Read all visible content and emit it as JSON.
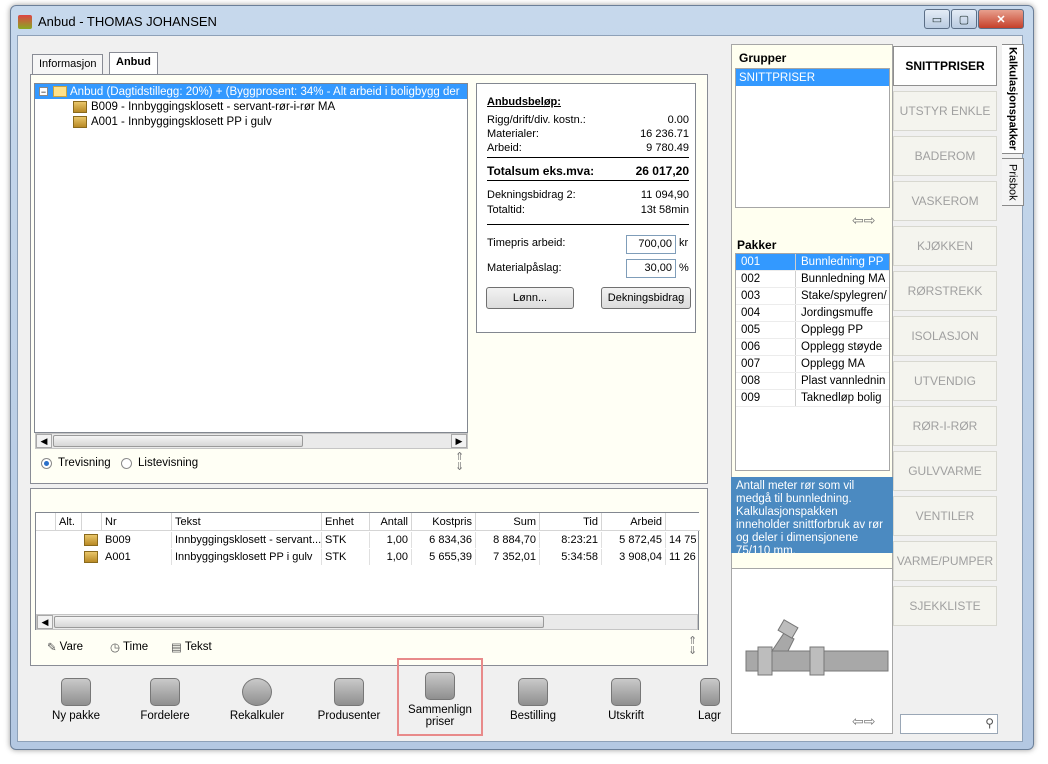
{
  "window": {
    "title": "Anbud - THOMAS JOHANSEN",
    "min": "▭",
    "max": "▢",
    "close": "✕"
  },
  "tabs": [
    {
      "label": "Informasjon"
    },
    {
      "label": "Anbud"
    }
  ],
  "tree": {
    "root": "Anbud (Dagtidstillegg: 20%) + (Byggprosent: 34% - Alt arbeid i boligbygg der",
    "children": [
      "B009 - Innbyggingsklosett - servant-rør-i-rør MA",
      "A001 - Innbyggingsklosett  PP i gulv"
    ]
  },
  "view_options": {
    "tree": "Trevisning",
    "list": "Listevisning"
  },
  "summary": {
    "heading": "Anbudsbeløp:",
    "rows": [
      {
        "label": "Rigg/drift/div. kostn.:",
        "value": "0.00"
      },
      {
        "label": "Materialer:",
        "value": "16 236.71"
      },
      {
        "label": "Arbeid:",
        "value": "9 780.49"
      }
    ],
    "total_label": "Totalsum eks.mva:",
    "total_value": "26 017,20",
    "db_label": "Dekningsbidrag 2:",
    "db_value": "11 094,90",
    "time_label": "Totaltid:",
    "time_value": "13t 58min",
    "rate_label": "Timepris arbeid:",
    "rate_value": "700,00",
    "rate_unit": "kr",
    "markup_label": "Materialpåslag:",
    "markup_value": "30,00",
    "markup_unit": "%",
    "btn_wage": "Lønn...",
    "btn_margin": "Dekningsbidrag"
  },
  "grid": {
    "headers": [
      "Alt.",
      "Nr",
      "Tekst",
      "Enhet",
      "Antall",
      "Kostpris",
      "Sum",
      "Tid",
      "Arbeid"
    ],
    "rows": [
      {
        "nr": "B009",
        "tekst": "Innbyggingsklosett - servant...",
        "enhet": "STK",
        "antall": "1,00",
        "kostpris": "6 834,36",
        "sum": "8 884,70",
        "tid": "8:23:21",
        "arbeid": "5 872,45",
        "extra": "14 75"
      },
      {
        "nr": "A001",
        "tekst": "Innbyggingsklosett  PP i gulv",
        "enhet": "STK",
        "antall": "1,00",
        "kostpris": "5 655,39",
        "sum": "7 352,01",
        "tid": "5:34:58",
        "arbeid": "3 908,04",
        "extra": "11 26"
      }
    ]
  },
  "add_options": {
    "vare": "Vare",
    "time": "Time",
    "tekst": "Tekst"
  },
  "toolbar": {
    "ny_pakke": "Ny pakke",
    "fordelere": "Fordelere",
    "rekalkuler": "Rekalkuler",
    "produsenter": "Produsenter",
    "sammenlign": "Sammenlign priser",
    "bestilling": "Bestilling",
    "utskrift": "Utskrift",
    "lagre": "Lagr"
  },
  "grupper": {
    "heading": "Grupper",
    "items": [
      "SNITTPRISER"
    ]
  },
  "pakker": {
    "heading": "Pakker",
    "items": [
      {
        "n": "001",
        "t": "Bunnledning PP"
      },
      {
        "n": "002",
        "t": "Bunnledning MA"
      },
      {
        "n": "003",
        "t": "Stake/spylegren/"
      },
      {
        "n": "004",
        "t": "Jordingsmuffe"
      },
      {
        "n": "005",
        "t": "Opplegg PP"
      },
      {
        "n": "006",
        "t": "Opplegg støyde"
      },
      {
        "n": "007",
        "t": "Opplegg MA"
      },
      {
        "n": "008",
        "t": "Plast vannlednin"
      },
      {
        "n": "009",
        "t": "Taknedløp bolig"
      }
    ]
  },
  "description": "Antall meter rør som vil medgå til bunnledning. Kalkulasjonspakken inneholder snittforbruk av rør og deler i dimensjonene 75/110 mm.",
  "categories": [
    "SNITTPRISER",
    "UTSTYR  ENKLE",
    "BADEROM",
    "VASKEROM",
    "KJØKKEN",
    "RØRSTREKK",
    "ISOLASJON",
    "UTVENDIG",
    "RØR-I-RØR",
    "GULVVARME",
    "VENTILER",
    "VARME/PUMPER",
    "SJEKKLISTE"
  ],
  "side_tabs": {
    "kalk": "Kalkulasjonspakker",
    "prisbok": "Prisbok"
  },
  "colors": {
    "selection": "#3399ff",
    "description_bg": "#4b8ac1",
    "highlight_border": "#e88a8a"
  }
}
